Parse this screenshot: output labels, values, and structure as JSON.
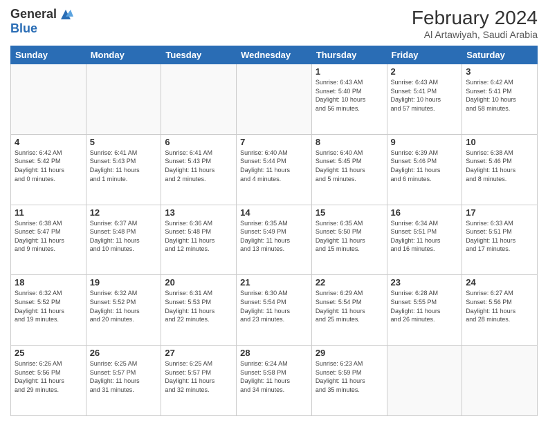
{
  "logo": {
    "line1": "General",
    "line2": "Blue"
  },
  "title": "February 2024",
  "location": "Al Artawiyah, Saudi Arabia",
  "headers": [
    "Sunday",
    "Monday",
    "Tuesday",
    "Wednesday",
    "Thursday",
    "Friday",
    "Saturday"
  ],
  "weeks": [
    [
      {
        "day": "",
        "info": ""
      },
      {
        "day": "",
        "info": ""
      },
      {
        "day": "",
        "info": ""
      },
      {
        "day": "",
        "info": ""
      },
      {
        "day": "1",
        "info": "Sunrise: 6:43 AM\nSunset: 5:40 PM\nDaylight: 10 hours\nand 56 minutes."
      },
      {
        "day": "2",
        "info": "Sunrise: 6:43 AM\nSunset: 5:41 PM\nDaylight: 10 hours\nand 57 minutes."
      },
      {
        "day": "3",
        "info": "Sunrise: 6:42 AM\nSunset: 5:41 PM\nDaylight: 10 hours\nand 58 minutes."
      }
    ],
    [
      {
        "day": "4",
        "info": "Sunrise: 6:42 AM\nSunset: 5:42 PM\nDaylight: 11 hours\nand 0 minutes."
      },
      {
        "day": "5",
        "info": "Sunrise: 6:41 AM\nSunset: 5:43 PM\nDaylight: 11 hours\nand 1 minute."
      },
      {
        "day": "6",
        "info": "Sunrise: 6:41 AM\nSunset: 5:43 PM\nDaylight: 11 hours\nand 2 minutes."
      },
      {
        "day": "7",
        "info": "Sunrise: 6:40 AM\nSunset: 5:44 PM\nDaylight: 11 hours\nand 4 minutes."
      },
      {
        "day": "8",
        "info": "Sunrise: 6:40 AM\nSunset: 5:45 PM\nDaylight: 11 hours\nand 5 minutes."
      },
      {
        "day": "9",
        "info": "Sunrise: 6:39 AM\nSunset: 5:46 PM\nDaylight: 11 hours\nand 6 minutes."
      },
      {
        "day": "10",
        "info": "Sunrise: 6:38 AM\nSunset: 5:46 PM\nDaylight: 11 hours\nand 8 minutes."
      }
    ],
    [
      {
        "day": "11",
        "info": "Sunrise: 6:38 AM\nSunset: 5:47 PM\nDaylight: 11 hours\nand 9 minutes."
      },
      {
        "day": "12",
        "info": "Sunrise: 6:37 AM\nSunset: 5:48 PM\nDaylight: 11 hours\nand 10 minutes."
      },
      {
        "day": "13",
        "info": "Sunrise: 6:36 AM\nSunset: 5:48 PM\nDaylight: 11 hours\nand 12 minutes."
      },
      {
        "day": "14",
        "info": "Sunrise: 6:35 AM\nSunset: 5:49 PM\nDaylight: 11 hours\nand 13 minutes."
      },
      {
        "day": "15",
        "info": "Sunrise: 6:35 AM\nSunset: 5:50 PM\nDaylight: 11 hours\nand 15 minutes."
      },
      {
        "day": "16",
        "info": "Sunrise: 6:34 AM\nSunset: 5:51 PM\nDaylight: 11 hours\nand 16 minutes."
      },
      {
        "day": "17",
        "info": "Sunrise: 6:33 AM\nSunset: 5:51 PM\nDaylight: 11 hours\nand 17 minutes."
      }
    ],
    [
      {
        "day": "18",
        "info": "Sunrise: 6:32 AM\nSunset: 5:52 PM\nDaylight: 11 hours\nand 19 minutes."
      },
      {
        "day": "19",
        "info": "Sunrise: 6:32 AM\nSunset: 5:52 PM\nDaylight: 11 hours\nand 20 minutes."
      },
      {
        "day": "20",
        "info": "Sunrise: 6:31 AM\nSunset: 5:53 PM\nDaylight: 11 hours\nand 22 minutes."
      },
      {
        "day": "21",
        "info": "Sunrise: 6:30 AM\nSunset: 5:54 PM\nDaylight: 11 hours\nand 23 minutes."
      },
      {
        "day": "22",
        "info": "Sunrise: 6:29 AM\nSunset: 5:54 PM\nDaylight: 11 hours\nand 25 minutes."
      },
      {
        "day": "23",
        "info": "Sunrise: 6:28 AM\nSunset: 5:55 PM\nDaylight: 11 hours\nand 26 minutes."
      },
      {
        "day": "24",
        "info": "Sunrise: 6:27 AM\nSunset: 5:56 PM\nDaylight: 11 hours\nand 28 minutes."
      }
    ],
    [
      {
        "day": "25",
        "info": "Sunrise: 6:26 AM\nSunset: 5:56 PM\nDaylight: 11 hours\nand 29 minutes."
      },
      {
        "day": "26",
        "info": "Sunrise: 6:25 AM\nSunset: 5:57 PM\nDaylight: 11 hours\nand 31 minutes."
      },
      {
        "day": "27",
        "info": "Sunrise: 6:25 AM\nSunset: 5:57 PM\nDaylight: 11 hours\nand 32 minutes."
      },
      {
        "day": "28",
        "info": "Sunrise: 6:24 AM\nSunset: 5:58 PM\nDaylight: 11 hours\nand 34 minutes."
      },
      {
        "day": "29",
        "info": "Sunrise: 6:23 AM\nSunset: 5:59 PM\nDaylight: 11 hours\nand 35 minutes."
      },
      {
        "day": "",
        "info": ""
      },
      {
        "day": "",
        "info": ""
      }
    ]
  ]
}
